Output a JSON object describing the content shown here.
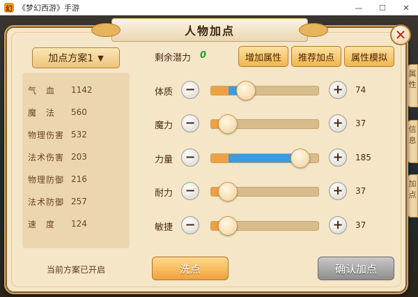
{
  "window": {
    "title": "《梦幻西游》手游",
    "icon_glyph": "幻",
    "min_glyph": "—",
    "max_glyph": "☐",
    "close_glyph": "✕"
  },
  "side_tabs": [
    {
      "label": "属性"
    },
    {
      "label": "信息"
    },
    {
      "label": "加点"
    }
  ],
  "panel": {
    "title": "人物加点",
    "close_glyph": "✕",
    "scheme": {
      "label": "加点方案1",
      "chevron": "▼"
    },
    "stats": [
      {
        "label": "气　血",
        "value": "1142"
      },
      {
        "label": "魔　法",
        "value": "560"
      },
      {
        "label": "物理伤害",
        "value": "532"
      },
      {
        "label": "法术伤害",
        "value": "203"
      },
      {
        "label": "物理防御",
        "value": "216"
      },
      {
        "label": "法术防御",
        "value": "257"
      },
      {
        "label": "速　度",
        "value": "124"
      }
    ],
    "plan_status": "当前方案已开启",
    "potential": {
      "label": "剩余潜力",
      "value": "0"
    },
    "top_buttons": [
      {
        "label": "增加属性"
      },
      {
        "label": "推荐加点"
      },
      {
        "label": "属性模拟"
      }
    ],
    "attributes": [
      {
        "label": "体质",
        "value": "74",
        "level_fraction": 0.33,
        "added_fraction": 0.17
      },
      {
        "label": "魔力",
        "value": "37",
        "level_fraction": 0.16,
        "added_fraction": 0.0
      },
      {
        "label": "力量",
        "value": "185",
        "level_fraction": 0.83,
        "added_fraction": 0.67
      },
      {
        "label": "耐力",
        "value": "37",
        "level_fraction": 0.16,
        "added_fraction": 0.0
      },
      {
        "label": "敏捷",
        "value": "37",
        "level_fraction": 0.16,
        "added_fraction": 0.0
      }
    ],
    "minus_glyph": "−",
    "plus_glyph": "+",
    "wash_button": "洗点",
    "confirm_button": "确认加点"
  },
  "colors": {
    "panel_bg": "#f5e6c8",
    "accent_orange": "#f0a040",
    "fill_blue": "#3d9be0",
    "potential_green": "#1aa52a",
    "close_red": "#d02010"
  }
}
